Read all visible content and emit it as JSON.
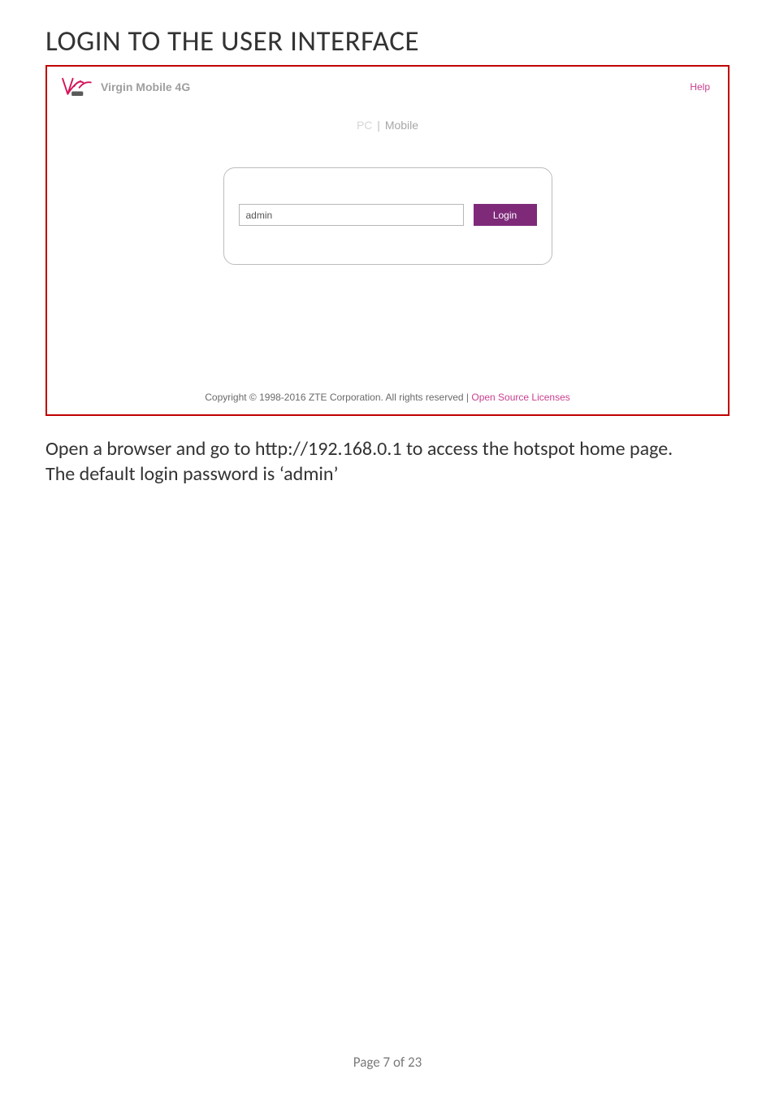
{
  "heading": "LOGIN TO THE USER INTERFACE",
  "header": {
    "brand_text": "Virgin Mobile 4G",
    "help_label": "Help"
  },
  "tabs": {
    "pc": "PC",
    "separator": "|",
    "mobile": "Mobile"
  },
  "login": {
    "input_value": "admin",
    "button_label": "Login"
  },
  "footer": {
    "copyright": "Copyright © 1998-2016 ZTE Corporation. All rights reserved",
    "separator": "  |  ",
    "link_label": "Open Source Licenses"
  },
  "body": {
    "line1": "Open a browser and go to http://192.168.0.1 to access the hotspot home page.",
    "line2": "The default login password is ‘admin’"
  },
  "page_indicator": "Page 7 of 23"
}
